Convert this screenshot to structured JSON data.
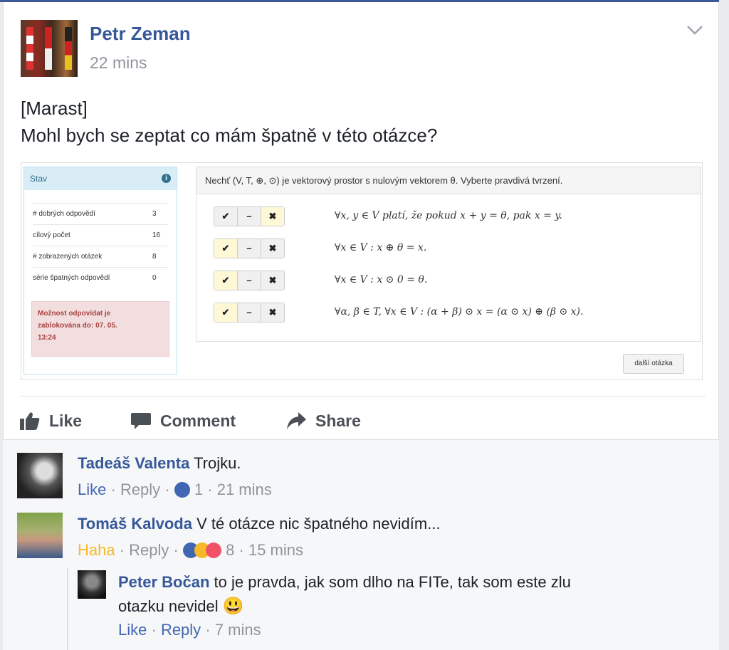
{
  "post": {
    "author": "Petr Zeman",
    "time": "22 mins",
    "text_line1": "[Marast]",
    "text_line2": "Mohl bych se zeptat co mám špatně v této otázce?"
  },
  "screenshot": {
    "stav_title": "Stav",
    "stats": [
      {
        "label": "# dobrých odpovědí",
        "value": "3"
      },
      {
        "label": "cílový počet",
        "value": "16"
      },
      {
        "label": "# zobrazených otázek",
        "value": "8"
      },
      {
        "label": "série špatných odpovědí",
        "value": "0"
      }
    ],
    "alert_line1": "Možnost odpovídat je",
    "alert_line2": "zablokována do: 07. 05.",
    "alert_line3": "13:24",
    "question": "Nechť (V, T, ⊕, ⊙) je vektorový prostor s nulovým vektorem θ. Vyberte pravdivá tvrzení.",
    "options": [
      {
        "check": "✔",
        "dash": "–",
        "cross": "✖",
        "statement": "∀x, y ∈ V platí, že pokud x + y = θ, pak x = y."
      },
      {
        "check": "✔",
        "dash": "–",
        "cross": "✖",
        "statement": "∀x ∈ V : x ⊕ θ = x."
      },
      {
        "check": "✔",
        "dash": "–",
        "cross": "✖",
        "statement": "∀x ∈ V : x ⊙ 0 = θ."
      },
      {
        "check": "✔",
        "dash": "–",
        "cross": "✖",
        "statement": "∀α, β ∈ T, ∀x ∈ V : (α + β) ⊙ x = (α ⊙ x) ⊕ (β ⊙ x)."
      }
    ],
    "next_button": "další otázka"
  },
  "actions": {
    "like": "Like",
    "comment": "Comment",
    "share": "Share"
  },
  "comments": [
    {
      "name": "Tadeáš Valenta",
      "text": "Trojku.",
      "like_label": "Like",
      "reply_label": "Reply",
      "reaction_count": "1",
      "time": "21 mins"
    },
    {
      "name": "Tomáš Kalvoda",
      "text": "V té otázce nic špatného nevidím...",
      "like_label": "Haha",
      "reply_label": "Reply",
      "reaction_count": "8",
      "time": "15 mins"
    }
  ],
  "reply": {
    "name": "Peter Bočan",
    "text_line1": "to je pravda, jak som dlho na FITe, tak som este zlu",
    "text_line2": "otazku nevidel",
    "emoji": "😃",
    "like_label": "Like",
    "reply_label": "Reply",
    "time": "7 mins"
  },
  "separator": "·"
}
